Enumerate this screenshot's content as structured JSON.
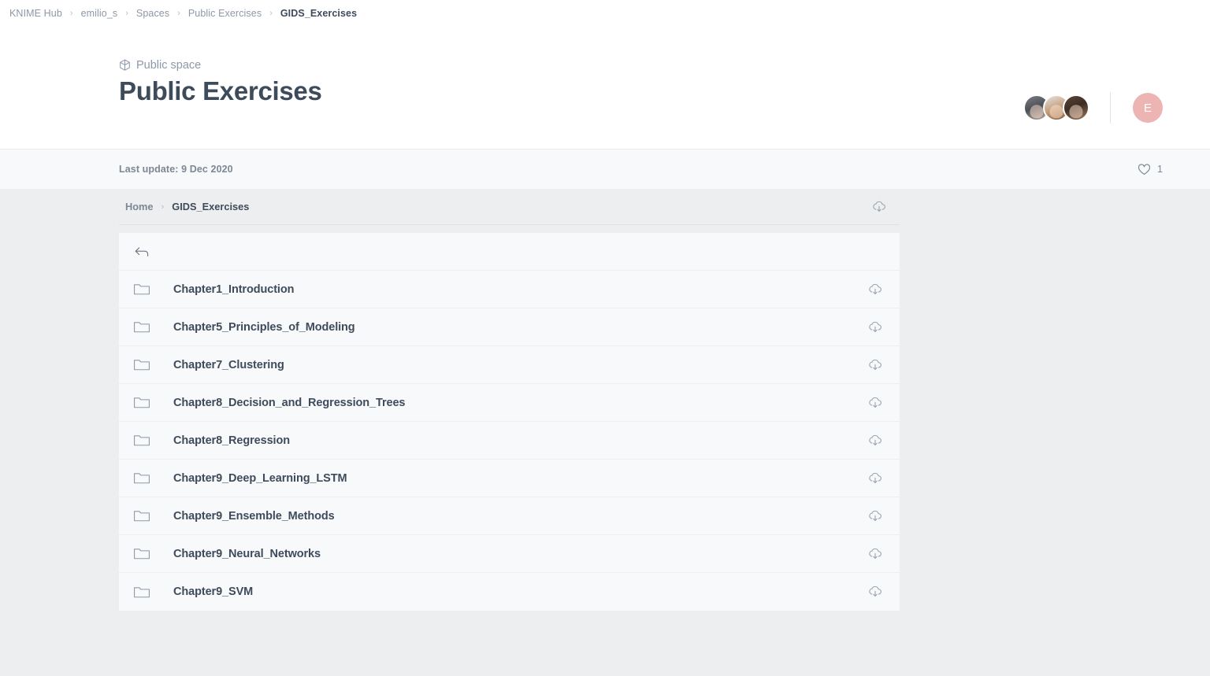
{
  "top_breadcrumb": {
    "items": [
      {
        "label": "KNIME Hub",
        "current": false
      },
      {
        "label": "emilio_s",
        "current": false
      },
      {
        "label": "Spaces",
        "current": false
      },
      {
        "label": "Public Exercises",
        "current": false
      },
      {
        "label": "GIDS_Exercises",
        "current": true
      }
    ],
    "separator": "›"
  },
  "space_header": {
    "kind_label": "Public space",
    "kind_icon": "hexagon-space-icon",
    "title": "Public Exercises",
    "collaborators": [
      {
        "name": "collaborator-1"
      },
      {
        "name": "collaborator-2"
      },
      {
        "name": "collaborator-3"
      }
    ],
    "user_avatar_initial": "E",
    "user_avatar_color": "#edb4b4"
  },
  "meta_bar": {
    "last_update": "Last update: 9 Dec 2020",
    "like_count": "1",
    "like_icon": "heart-icon"
  },
  "browser": {
    "breadcrumb": {
      "items": [
        {
          "label": "Home",
          "current": false
        },
        {
          "label": "GIDS_Exercises",
          "current": true
        }
      ],
      "separator": "›"
    },
    "download_all_icon": "cloud-download-icon",
    "back_row": {
      "label": "",
      "icon": "back-arrow-icon"
    },
    "row_icon": "folder-icon",
    "row_download_icon": "cloud-download-icon",
    "items": [
      {
        "name": "Chapter1_Introduction",
        "type": "folder"
      },
      {
        "name": "Chapter5_Principles_of_Modeling",
        "type": "folder"
      },
      {
        "name": "Chapter7_Clustering",
        "type": "folder"
      },
      {
        "name": "Chapter8_Decision_and_Regression_Trees",
        "type": "folder"
      },
      {
        "name": "Chapter8_Regression",
        "type": "folder"
      },
      {
        "name": "Chapter9_Deep_Learning_LSTM",
        "type": "folder"
      },
      {
        "name": "Chapter9_Ensemble_Methods",
        "type": "folder"
      },
      {
        "name": "Chapter9_Neural_Networks",
        "type": "folder"
      },
      {
        "name": "Chapter9_SVM",
        "type": "folder"
      }
    ]
  },
  "colors": {
    "text_primary": "#3e4b5b",
    "text_muted": "#8d98a8",
    "page_background": "#eceef0",
    "panel_background": "#f8f9fa"
  }
}
